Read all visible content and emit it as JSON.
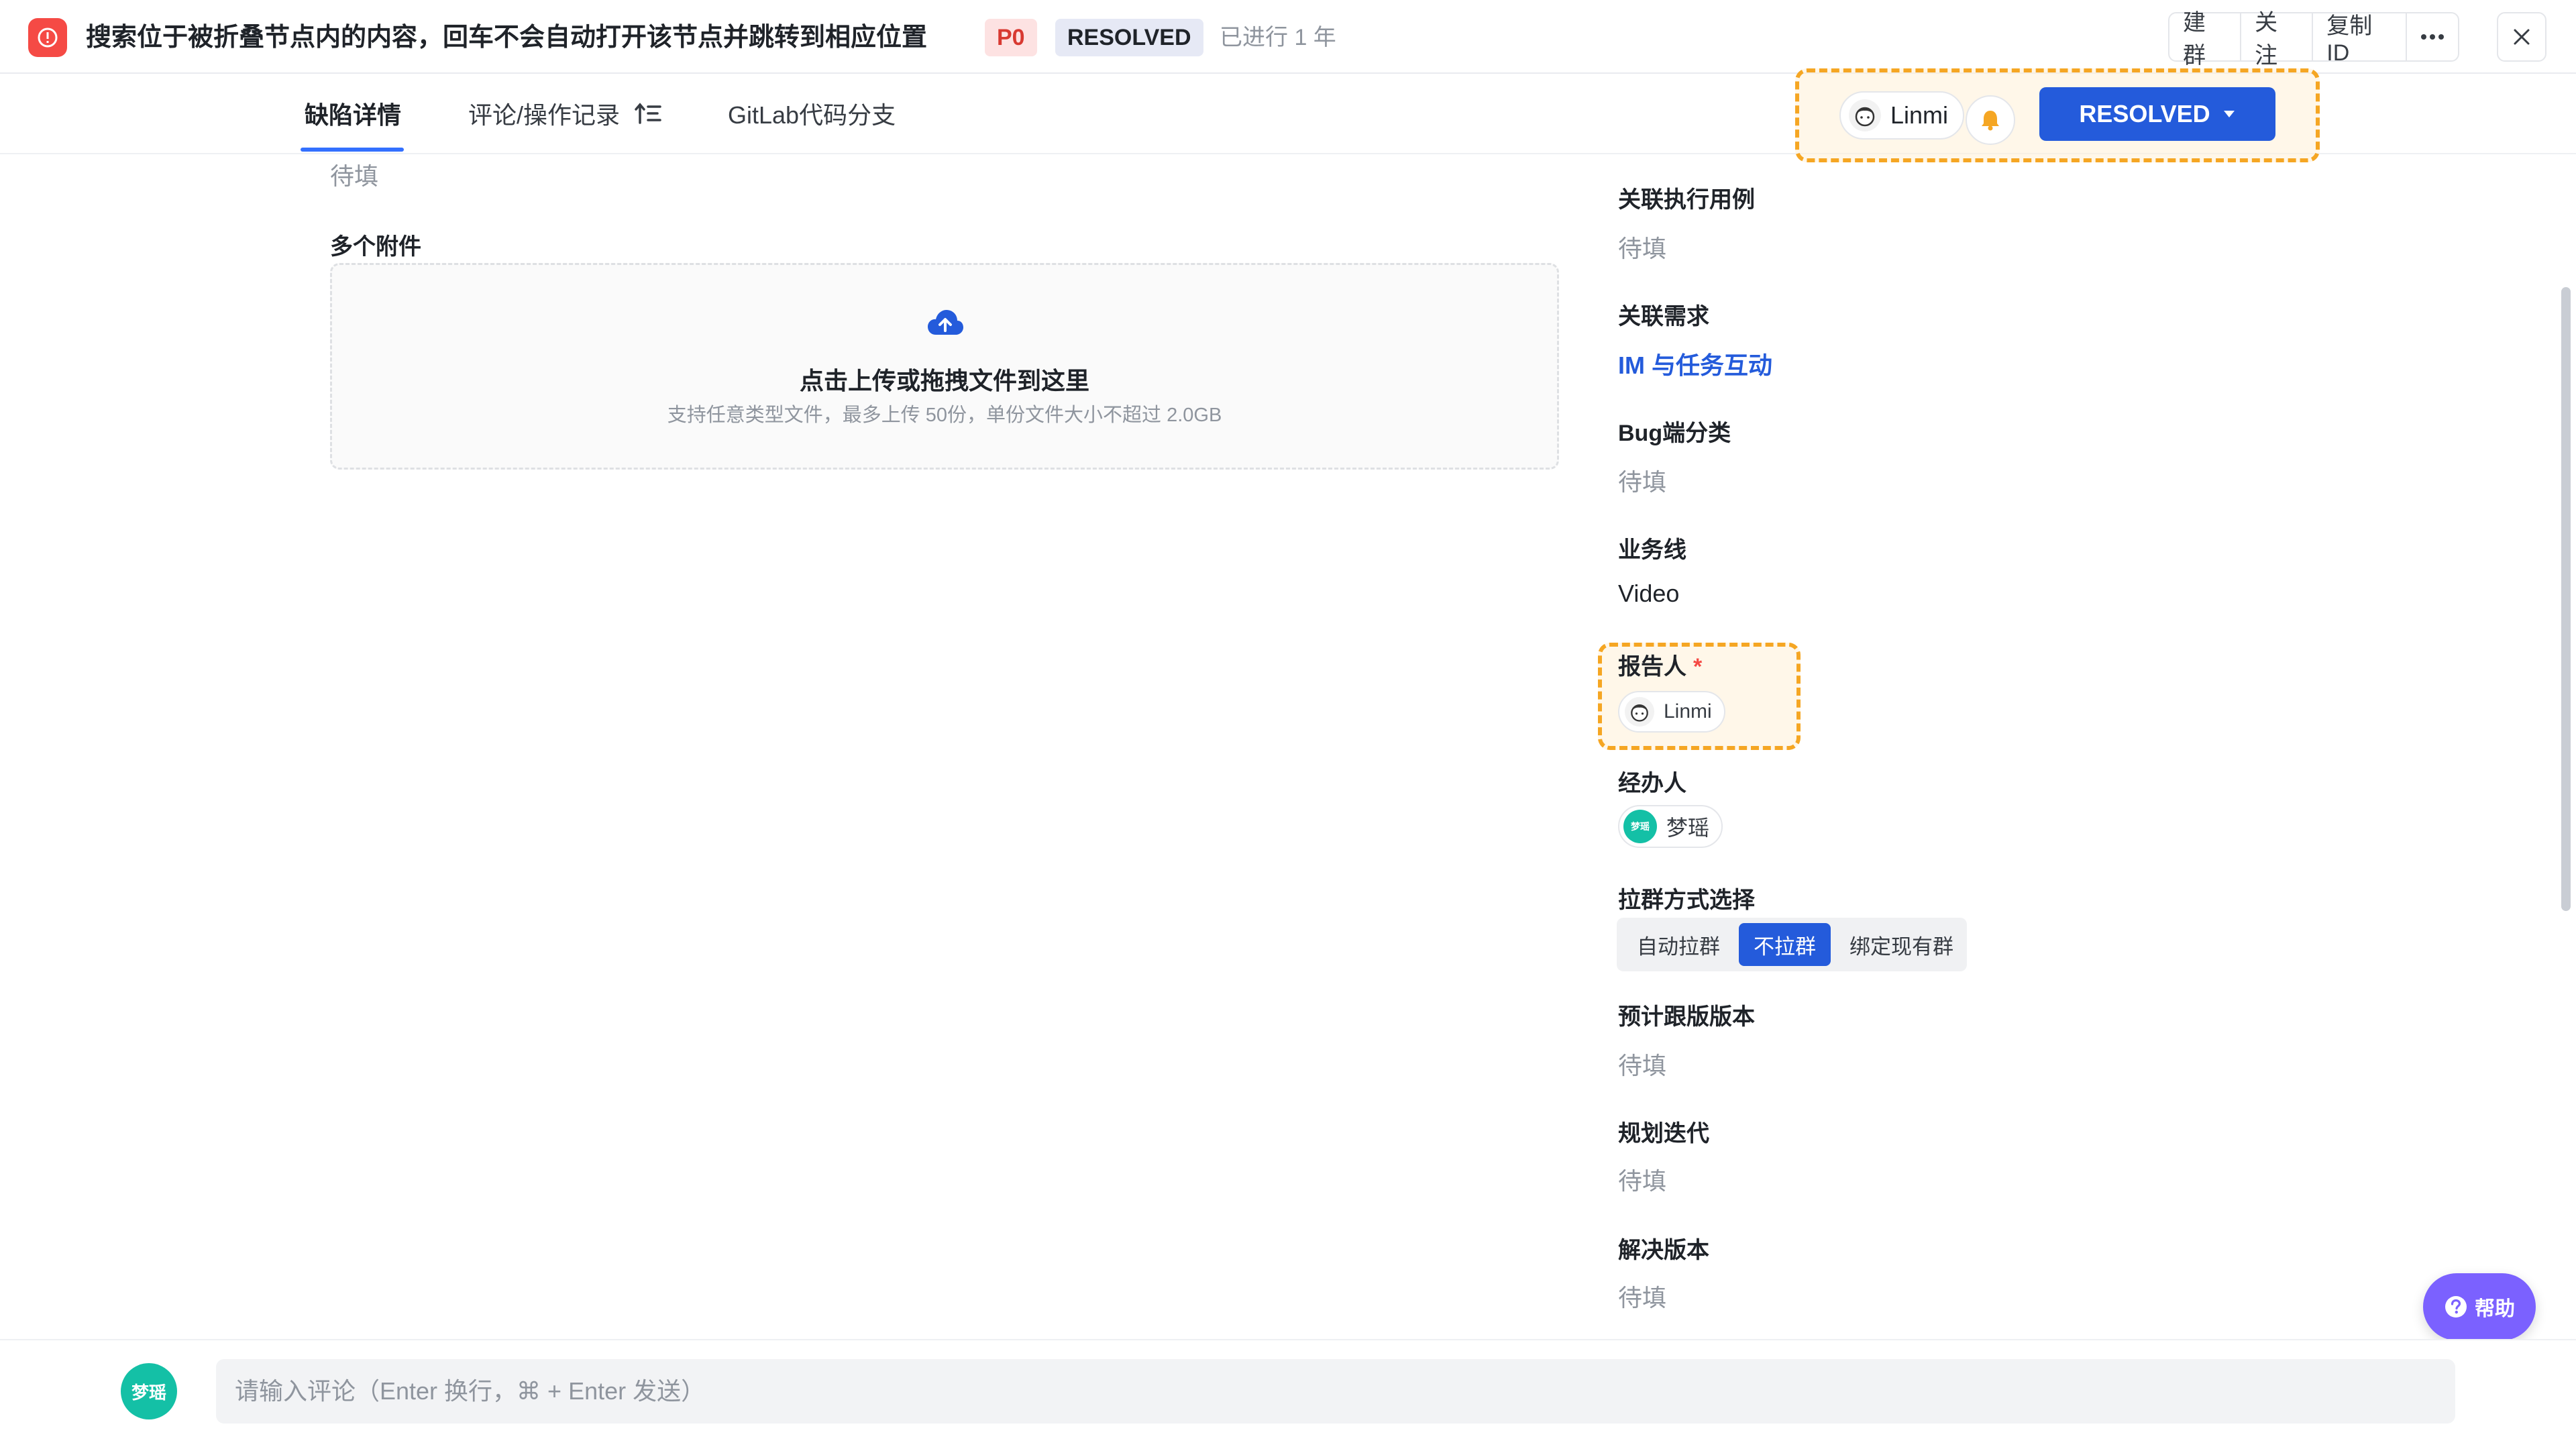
{
  "header": {
    "title": "搜索位于被折叠节点内的内容，回车不会自动打开该节点并跳转到相应位置",
    "priority": "P0",
    "status": "RESOLVED",
    "duration": "已进行 1 年",
    "actions": [
      "建群",
      "关注",
      "复制ID"
    ]
  },
  "tabs": [
    "缺陷详情",
    "评论/操作记录",
    "GitLab代码分支"
  ],
  "top_controls": {
    "owner_name": "Linmi",
    "status_button": "RESOLVED"
  },
  "left": {
    "prev_value": "待填",
    "attachments_label": "多个附件",
    "upload_title": "点击上传或拖拽文件到这里",
    "upload_hint": "支持任意类型文件，最多上传 50份，单份文件大小不超过 2.0GB"
  },
  "fields": {
    "exec_cases": {
      "label": "关联执行用例",
      "value": "待填"
    },
    "requirement": {
      "label": "关联需求",
      "value": "IM 与任务互动"
    },
    "bug_platform": {
      "label": "Bug端分类",
      "value": "待填"
    },
    "business_line": {
      "label": "业务线",
      "value": "Video"
    },
    "reporter": {
      "label": "报告人",
      "required_mark": "*",
      "value": "Linmi"
    },
    "assignee": {
      "label": "经办人",
      "value": "梦瑶",
      "avatar_text": "梦瑶"
    },
    "group_mode": {
      "label": "拉群方式选择",
      "options": [
        "自动拉群",
        "不拉群",
        "绑定现有群"
      ],
      "selected": "不拉群"
    },
    "expected_version": {
      "label": "预计跟版版本",
      "value": "待填"
    },
    "iteration": {
      "label": "规划迭代",
      "value": "待填"
    },
    "resolved_version": {
      "label": "解决版本",
      "value": "待填"
    }
  },
  "comment": {
    "avatar_text": "梦瑶",
    "placeholder": "请输入评论（Enter 换行，⌘ + Enter 发送）"
  },
  "help": {
    "label": "帮助"
  },
  "colors": {
    "primary": "#245bdb",
    "danger": "#f54a45",
    "highlight": "#f5a623",
    "help": "#7b61ff",
    "avatar": "#14c0a6"
  }
}
